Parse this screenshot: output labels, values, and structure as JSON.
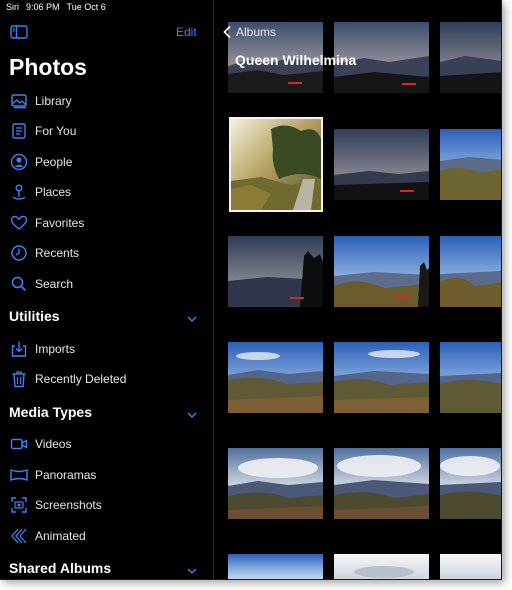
{
  "status_bar": {
    "assistant": "Siri",
    "time": "9:06 PM",
    "date": "Tue Oct 6"
  },
  "sidebar": {
    "edit_label": "Edit",
    "title": "Photos",
    "library_items": [
      {
        "label": "Library",
        "icon": "photo-library-icon"
      },
      {
        "label": "For You",
        "icon": "for-you-icon"
      },
      {
        "label": "People",
        "icon": "person-circle-icon"
      },
      {
        "label": "Places",
        "icon": "map-pin-icon"
      },
      {
        "label": "Favorites",
        "icon": "heart-icon"
      },
      {
        "label": "Recents",
        "icon": "clock-icon"
      },
      {
        "label": "Search",
        "icon": "search-icon"
      }
    ],
    "utilities": {
      "title": "Utilities",
      "items": [
        {
          "label": "Imports",
          "icon": "import-icon"
        },
        {
          "label": "Recently Deleted",
          "icon": "trash-icon"
        }
      ]
    },
    "media_types": {
      "title": "Media Types",
      "items": [
        {
          "label": "Videos",
          "icon": "video-icon"
        },
        {
          "label": "Panoramas",
          "icon": "panorama-icon"
        },
        {
          "label": "Screenshots",
          "icon": "screenshot-icon"
        },
        {
          "label": "Animated",
          "icon": "animated-icon"
        }
      ]
    },
    "shared_albums": {
      "title": "Shared Albums"
    }
  },
  "album": {
    "back_label": "Albums",
    "title": "Queen Wilhelmina"
  },
  "colors": {
    "accent": "#3b82f6",
    "background": "#000000",
    "text": "#e6e6e6"
  }
}
